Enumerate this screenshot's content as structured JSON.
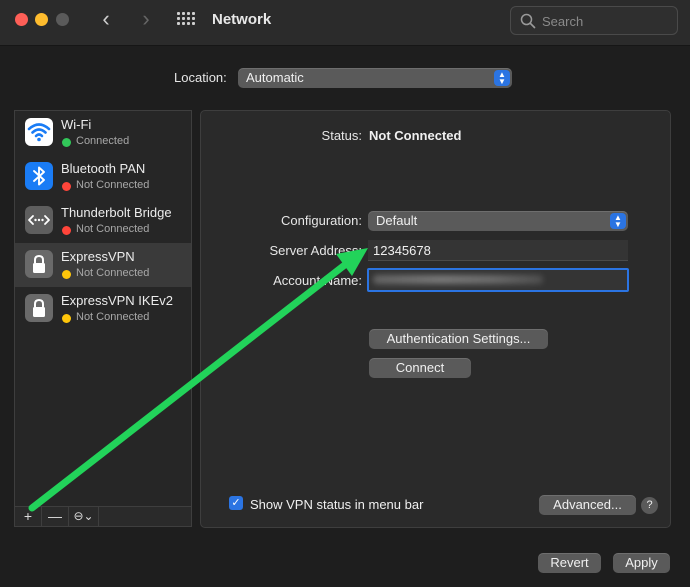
{
  "window": {
    "title": "Network",
    "search_placeholder": "Search"
  },
  "location": {
    "label": "Location:",
    "value": "Automatic"
  },
  "services": [
    {
      "name": "Wi-Fi",
      "status": "Connected",
      "status_color": "#32c759",
      "icon": "wifi-icon"
    },
    {
      "name": "Bluetooth PAN",
      "status": "Not Connected",
      "status_color": "#ff453a",
      "icon": "bluetooth-icon"
    },
    {
      "name": "Thunderbolt Bridge",
      "status": "Not Connected",
      "status_color": "#ff453a",
      "icon": "thunderbolt-bridge-icon"
    },
    {
      "name": "ExpressVPN",
      "status": "Not Connected",
      "status_color": "#ffc60a",
      "icon": "lock-icon"
    },
    {
      "name": "ExpressVPN IKEv2",
      "status": "Not Connected",
      "status_color": "#ffc60a",
      "icon": "lock-icon"
    }
  ],
  "selected_service": "ExpressVPN",
  "sidebar_tools": {
    "add": "+",
    "remove": "—",
    "action": "⊖⌄"
  },
  "detail": {
    "status_label": "Status:",
    "status_value": "Not Connected",
    "configuration_label": "Configuration:",
    "configuration_value": "Default",
    "server_address_label": "Server Address:",
    "server_address_value": "12345678",
    "account_name_label": "Account Name:",
    "auth_settings_button": "Authentication Settings...",
    "connect_button": "Connect",
    "show_vpn_status_label": "Show VPN status in menu bar",
    "show_vpn_status_checked": true,
    "advanced_button": "Advanced...",
    "help": "?"
  },
  "footer": {
    "revert_button": "Revert",
    "apply_button": "Apply"
  },
  "colors": {
    "accent": "#2b74e2",
    "annotation_arrow": "#22d35a"
  }
}
